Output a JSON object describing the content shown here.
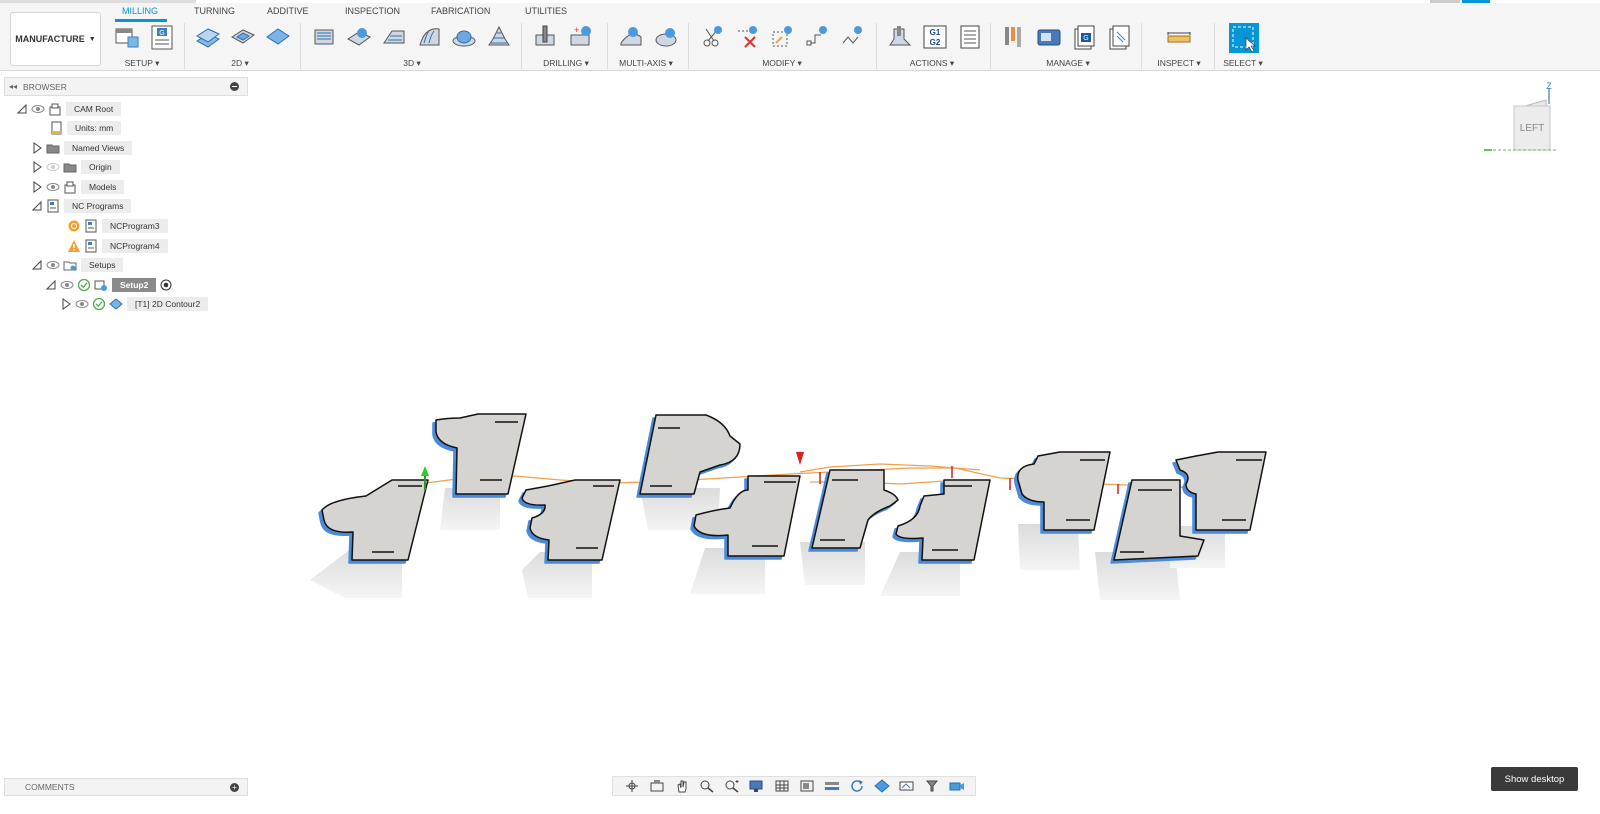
{
  "workspace": {
    "label": "MANUFACTURE"
  },
  "tabs": [
    {
      "label": "MILLING",
      "active": true
    },
    {
      "label": "TURNING"
    },
    {
      "label": "ADDITIVE"
    },
    {
      "label": "INSPECTION"
    },
    {
      "label": "FABRICATION"
    },
    {
      "label": "UTILITIES"
    }
  ],
  "groups": [
    "SETUP",
    "2D",
    "3D",
    "DRILLING",
    "MULTI-AXIS",
    "MODIFY",
    "ACTIONS",
    "MANAGE",
    "INSPECT",
    "SELECT"
  ],
  "browser": {
    "title": "BROWSER",
    "nodes": {
      "cam_root": "CAM Root",
      "units": "Units: mm",
      "named_views": "Named Views",
      "origin": "Origin",
      "models": "Models",
      "nc_programs": "NC Programs",
      "ncprogram3": "NCProgram3",
      "ncprogram4": "NCProgram4",
      "setups": "Setups",
      "setup2": "Setup2",
      "contour": "[T1] 2D Contour2"
    }
  },
  "viewcube": {
    "face": "LEFT",
    "axis_z": "Z"
  },
  "comments": {
    "title": "COMMENTS"
  },
  "tooltip": {
    "text": "Show desktop"
  },
  "colors": {
    "accent": "#0696d7",
    "part_face": "#d6d4d0",
    "part_edge": "#4a8ad8",
    "toolpath": "#f0a050",
    "warning": "#f0a030"
  }
}
